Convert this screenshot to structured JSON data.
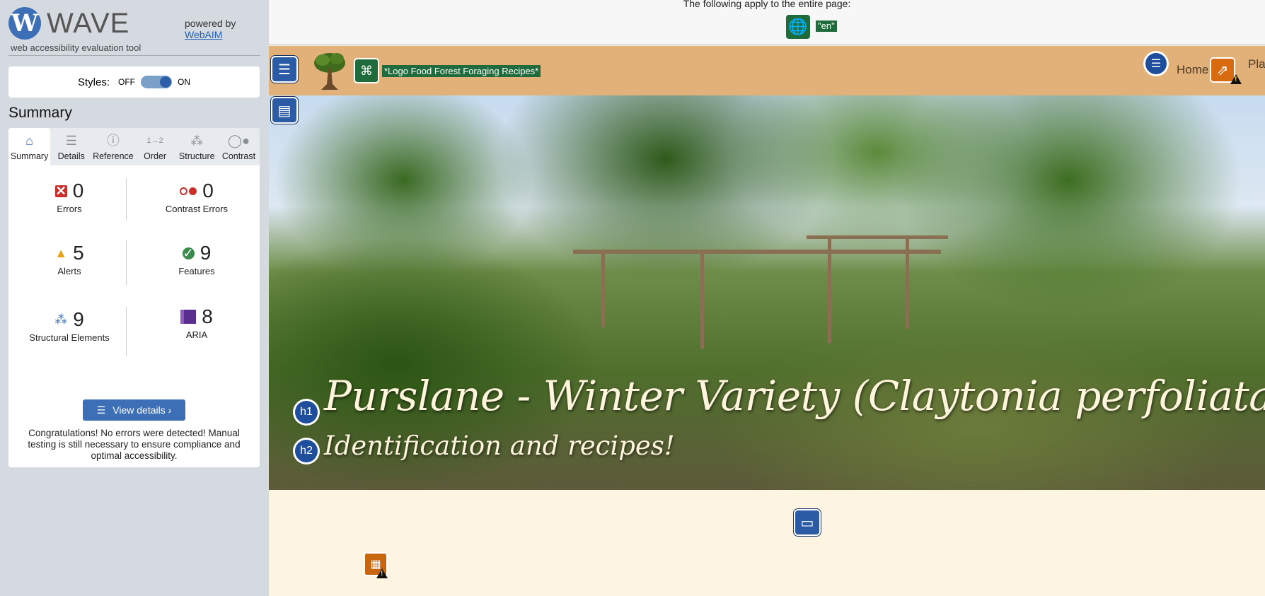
{
  "wave": {
    "logo_letter": "W",
    "logo_text": "WAVE",
    "tagline": "web accessibility evaluation tool",
    "powered_by": "powered by",
    "powered_link": "WebAIM",
    "styles": {
      "label": "Styles:",
      "off": "OFF",
      "on": "ON",
      "state": "on"
    },
    "summary_heading": "Summary",
    "tabs": [
      {
        "label": "Summary",
        "icon": "home-icon",
        "active": true
      },
      {
        "label": "Details",
        "icon": "list-icon",
        "active": false
      },
      {
        "label": "Reference",
        "icon": "info-icon",
        "active": false
      },
      {
        "label": "Order",
        "icon": "order-icon",
        "active": false
      },
      {
        "label": "Structure",
        "icon": "structure-icon",
        "active": false
      },
      {
        "label": "Contrast",
        "icon": "contrast-icon",
        "active": false
      }
    ],
    "stats": {
      "errors": {
        "count": "0",
        "label": "Errors"
      },
      "contrast_errors": {
        "count": "0",
        "label": "Contrast Errors"
      },
      "alerts": {
        "count": "5",
        "label": "Alerts"
      },
      "features": {
        "count": "9",
        "label": "Features"
      },
      "structural": {
        "count": "9",
        "label": "Structural Elements"
      },
      "aria": {
        "count": "8",
        "label": "ARIA"
      }
    },
    "view_details": "View details ›",
    "congrats": "Congratulations! No errors were detected! Manual testing is still necessary to ensure compliance and optimal accessibility.",
    "colors": {
      "accent": "#3d6fb6",
      "sidebar_bg": "#d5dae1",
      "error": "#c9302c",
      "alert": "#e9a11b",
      "feature": "#3a8a4b",
      "aria": "#5a2e8f"
    }
  },
  "page": {
    "lang_notice": "The following apply to the entire page:",
    "lang_tag": "\"en\"",
    "logo_tag": "*Logo Food Forest Foraging Recipes*",
    "nav_home": "Home",
    "nav_partial": "Pla",
    "hero_h1": "Purslane - Winter Variety (Claytonia perfoliata)",
    "hero_h2": "Identification and recipes!",
    "h1_badge": "h1",
    "h2_badge": "h2",
    "colors": {
      "nav_bg": "#e2b079",
      "page_bg": "#fdf5e2",
      "wave_green": "#1f6b3b",
      "wave_blue": "#1f4e9c",
      "wave_orange": "#d86b10"
    }
  }
}
